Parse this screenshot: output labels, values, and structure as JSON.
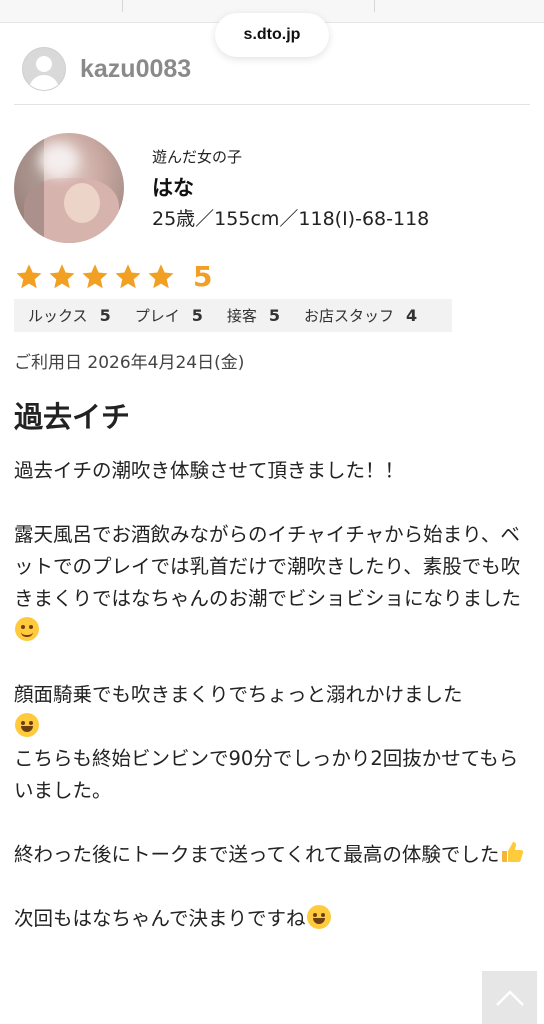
{
  "browser": {
    "url": "s.dto.jp"
  },
  "reviewer": {
    "username": "kazu0083",
    "icon": "user-avatar-icon"
  },
  "girl": {
    "caption": "遊んだ女の子",
    "name": "はな",
    "stats": "25歳／155cm／118(I)-68-118"
  },
  "rating": {
    "stars": 5,
    "max_stars": 5,
    "value": "5",
    "star_color": "#f2a024",
    "subscores": [
      {
        "label": "ルックス",
        "value": "5"
      },
      {
        "label": "プレイ",
        "value": "5"
      },
      {
        "label": "接客",
        "value": "5"
      },
      {
        "label": "お店スタッフ",
        "value": "4"
      }
    ]
  },
  "visit": {
    "date": "ご利用日 2026年4月24日(金)"
  },
  "review": {
    "title": "過去イチ",
    "p1": "過去イチの潮吹き体験させて頂きました！！",
    "p2": "露天風呂でお酒飲みながらのイチャイチャから始まり、ベットでのプレイでは乳首だけで潮吹きしたり、素股でも吹きまくりではなちゃんのお潮でビショビショになりました",
    "p3a": "顔面騎乗でも吹きまくりでちょっと溺れかけました",
    "p3b": "こちらも終始ビンビンで90分でしっかり2回抜かせてもらいました。",
    "p4": "終わった後にトークまで送ってくれて最高の体験でした",
    "p5": "次回もはなちゃんで決まりですね"
  },
  "icons": {
    "emoji1": "smiling-blush-emoji",
    "emoji2": "grinning-emoji",
    "emoji3": "thumbs-up-emoji",
    "emoji4": "laughing-emoji",
    "scroll_top": "chevron-up-icon"
  }
}
